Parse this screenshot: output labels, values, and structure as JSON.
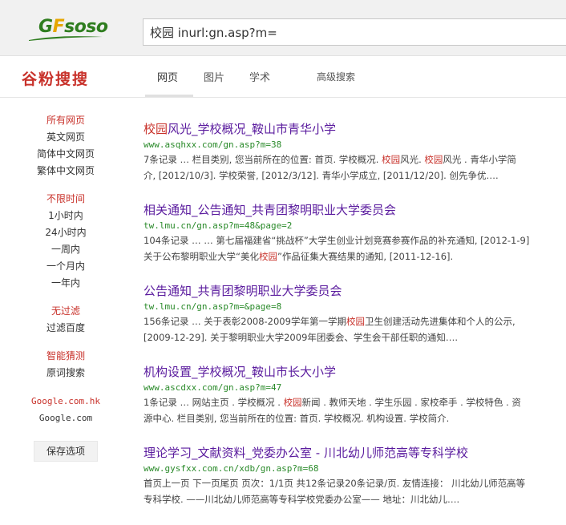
{
  "header": {
    "logo_g": "G",
    "logo_f": "F",
    "logo_rest": "soso",
    "search_query": "校园 inurl:gn.asp?m=",
    "brand": "谷粉搜搜"
  },
  "nav": {
    "tabs": [
      {
        "label": "网页"
      },
      {
        "label": "图片"
      },
      {
        "label": "学术"
      }
    ],
    "advanced": "高级搜索"
  },
  "sidebar": {
    "lang": {
      "head": "所有网页",
      "items": [
        "英文网页",
        "简体中文网页",
        "繁体中文网页"
      ]
    },
    "time": {
      "head": "不限时间",
      "items": [
        "1小时内",
        "24小时内",
        "一周内",
        "一个月内",
        "一年内"
      ]
    },
    "filter": {
      "head": "无过滤",
      "items": [
        "过滤百度"
      ]
    },
    "guess": {
      "head": "智能猜测",
      "items": [
        "原词搜索"
      ]
    },
    "google_hk": "Google.com.hk",
    "google": "Google.com",
    "save": "保存选项"
  },
  "results": [
    {
      "title_hl": "校园",
      "title_rest": "风光_学校概况_鞍山市青华小学",
      "url": "www.asqhxx.com/gn.asp?m=38",
      "s1a": "7条记录 … 栏目类别, 您当前所在的位置: 首页. 学校概况. ",
      "s1hl": "校园",
      "s1b": "风光. ",
      "s1hl2": "校园",
      "s1c": "风光 . 青华小学简",
      "s2": "介, [2012/10/3]. 学校荣誉, [2012/3/12]. 青华小学成立, [2011/12/20]. 创先争优…."
    },
    {
      "title": "相关通知_公告通知_共青团黎明职业大学委员会",
      "url": "tw.lmu.cn/gn.asp?m=48&page=2",
      "s1": "104条记录 … … 第七届福建省“挑战杯”大学生创业计划竞赛参赛作品的补充通知, [2012-1-9]",
      "s2a": "关于公布黎明职业大学“美化",
      "s2hl": "校园",
      "s2b": "”作品征集大赛结果的通知, [2011-12-16]."
    },
    {
      "title": "公告通知_共青团黎明职业大学委员会",
      "url": "tw.lmu.cn/gn.asp?m=&page=8",
      "s1a": "156条记录 … 关于表彰2008-2009学年第一学期",
      "s1hl": "校园",
      "s1b": "卫生创建活动先进集体和个人的公示,",
      "s2": "[2009-12-29]. 关于黎明职业大学2009年团委会、学生会干部任职的通知…."
    },
    {
      "title": "机构设置_学校概况_鞍山市长大小学",
      "url": "www.ascdxx.com/gn.asp?m=47",
      "s1a": "1条记录 … 网站主页 . 学校概况 . ",
      "s1hl": "校园",
      "s1b": "新闻 . 教师天地 . 学生乐园 . 家校牵手 . 学校特色 . 资",
      "s2": "源中心. 栏目类别, 您当前所在的位置: 首页. 学校概况. 机构设置. 学校简介."
    },
    {
      "title": "理论学习_文献资料_党委办公室 - 川北幼儿师范高等专科学校",
      "url": "www.gysfxx.com.cn/xdb/gn.asp?m=68",
      "s1": "首页上一页 下一页尾页 页次：1/1页 共12条记录20条记录/页. 友情连接： 川北幼儿师范高等",
      "s2": "专科学校. ——川北幼儿师范高等专科学校党委办公室—— 地址：川北幼儿…."
    }
  ]
}
